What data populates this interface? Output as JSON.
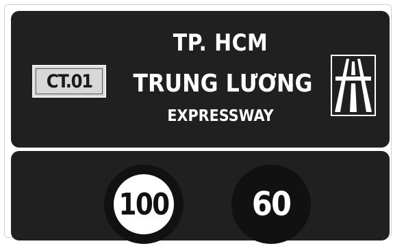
{
  "sign": {
    "route_code": "CT.01",
    "destinations": [
      "TP. HCM",
      "TRUNG LƯƠNG",
      "EXPRESSWAY"
    ],
    "speed_min": "100",
    "speed_max": "60"
  },
  "icons": {
    "expressway": "expressway-icon",
    "minimum_speed_sign": "min-speed-sign-icon",
    "maximum_speed_sign": "max-speed-sign-icon"
  },
  "colors": {
    "panel": "#202020",
    "text": "#ffffff",
    "shield": "#d8d8d8"
  }
}
